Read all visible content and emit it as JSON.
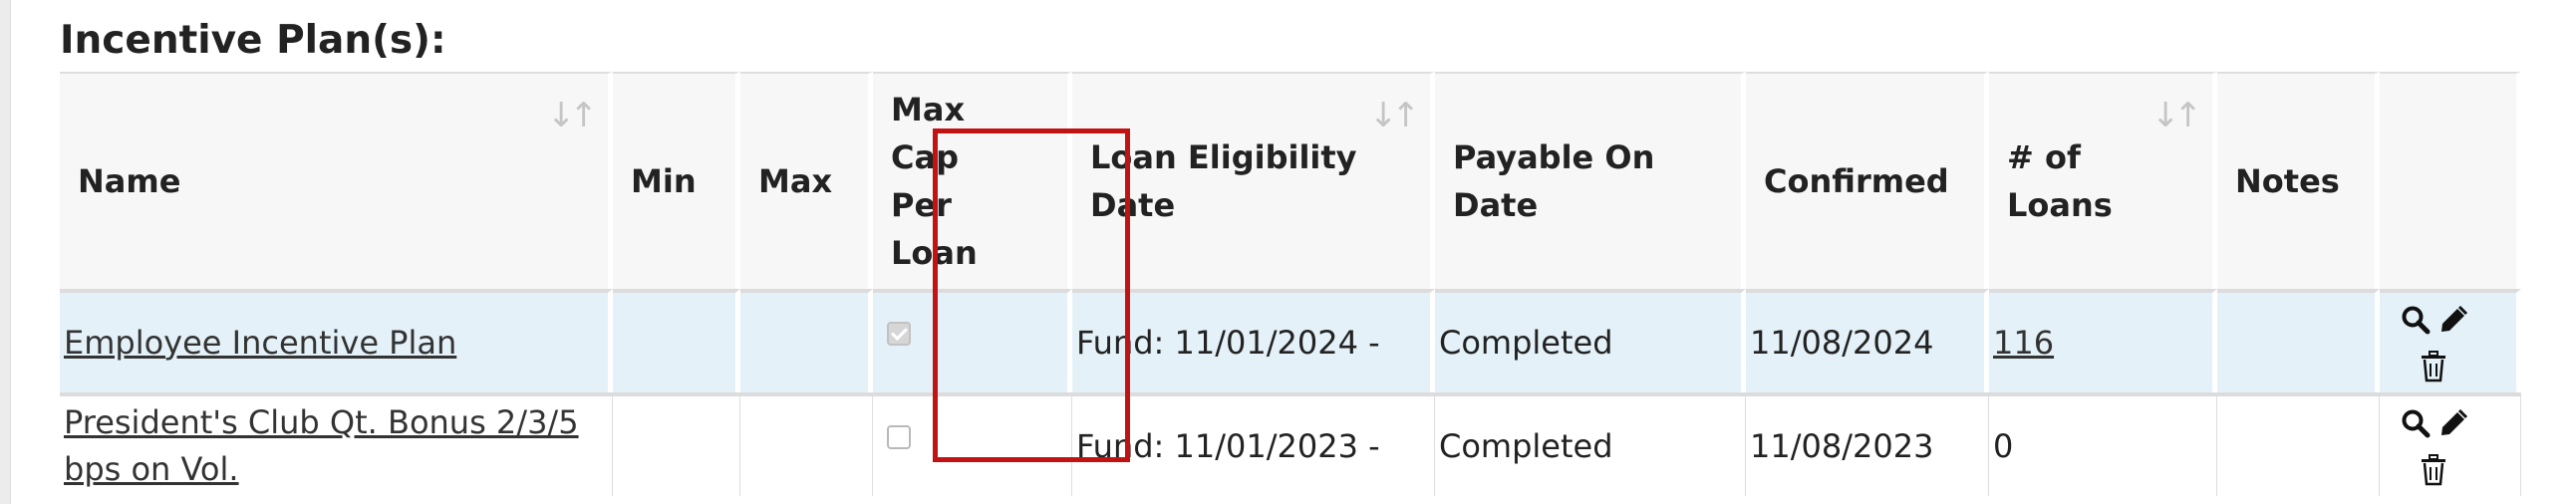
{
  "section": {
    "title": "Incentive Plan(s):"
  },
  "table": {
    "headers": {
      "name": "Name",
      "min": "Min",
      "max": "Max",
      "max_cap": [
        "Max",
        "Cap",
        "Per",
        "Loan"
      ],
      "loan_eligibility": [
        "Loan Eligibility",
        "Date"
      ],
      "payable_on": [
        "Payable On",
        "Date"
      ],
      "confirmed": "Confirmed",
      "num_loans": [
        "# of",
        "Loans"
      ],
      "notes": "Notes"
    },
    "rows": [
      {
        "name": "Employee Incentive Plan",
        "min": "",
        "max": "",
        "max_cap_per_loan": true,
        "loan_eligibility_date": "Fund: 11/01/2024 -",
        "payable_on_date": "Completed",
        "confirmed": "11/08/2024",
        "num_loans": "116",
        "notes": ""
      },
      {
        "name_lines": [
          "President's Club Qt. Bonus 2/3/5",
          "bps on Vol."
        ],
        "min": "",
        "max": "",
        "max_cap_per_loan": false,
        "loan_eligibility_date": "Fund: 11/01/2023 -",
        "payable_on_date": "Completed",
        "confirmed": "11/08/2023",
        "num_loans": "0",
        "notes": ""
      }
    ]
  },
  "icons": [
    "sort-icon",
    "search-icon",
    "edit-pencil-icon",
    "trash-icon"
  ],
  "colors": {
    "highlight": "#c01414",
    "row_highlight": "#e4f1f8",
    "header_bg": "#f7f7f7"
  }
}
